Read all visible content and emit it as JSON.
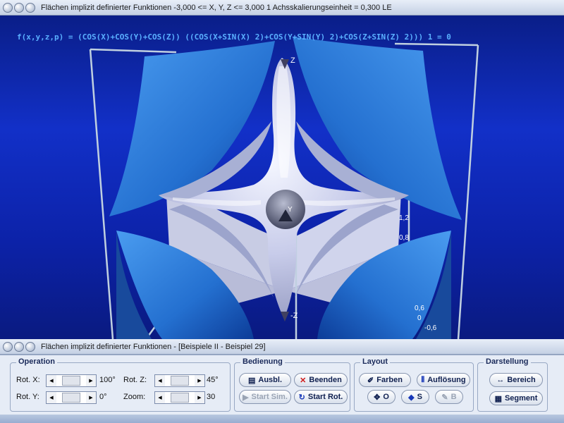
{
  "top_window": {
    "title": "Flächen implizit definierter Funktionen   -3,000 <= X, Y, Z <= 3,000    1 Achsskalierungseinheit = 0,300 LE"
  },
  "viewport": {
    "formula": "f(x,y,z,p) = (COS(X)+COS(Y)+COS(Z)) ((COS(X+SIN(X) 2)+COS(Y+SIN(Y) 2)+COS(Z+SIN(Z) 2))) 1 = 0",
    "axis_labels": {
      "z_pos": "Z",
      "z_neg": "-Z",
      "y": "Y",
      "tick_1": "1,2",
      "tick_2": "0,8",
      "tick_3": "0,6",
      "tick_4": "0",
      "tick_5": "-0,6"
    },
    "colors": {
      "background": "#1230c8",
      "surface_blue": "#2a78d8",
      "surface_light": "#c8cce4",
      "formula": "#5ab0ff"
    }
  },
  "bottom_window": {
    "title": "Flächen implizit definierter Funktionen - [Beispiele II - Beispiel 29]"
  },
  "operation": {
    "title": "Operation",
    "rot_x_label": "Rot. X:",
    "rot_x_value": "100°",
    "rot_y_label": "Rot. Y:",
    "rot_y_value": "0°",
    "rot_z_label": "Rot. Z:",
    "rot_z_value": "45°",
    "zoom_label": "Zoom:",
    "zoom_value": "30"
  },
  "bedienung": {
    "title": "Bedienung",
    "ausbl": "Ausbl.",
    "beenden": "Beenden",
    "start_sim": "Start Sim.",
    "start_rot": "Start Rot."
  },
  "layout": {
    "title": "Layout",
    "farben": "Farben",
    "aufloesung": "Auflösung",
    "o": "O",
    "s": "S",
    "b": "B"
  },
  "darstellung": {
    "title": "Darstellung",
    "bereich": "Bereich",
    "segment": "Segment"
  }
}
